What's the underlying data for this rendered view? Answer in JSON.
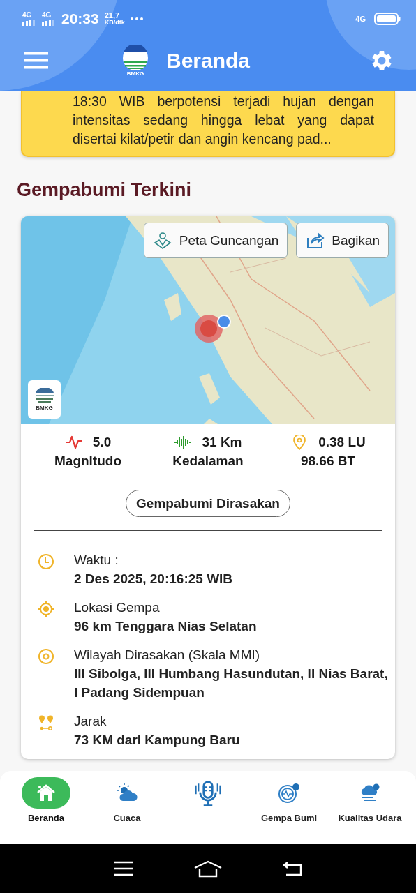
{
  "status_bar": {
    "network_1": "4G",
    "network_2": "4G",
    "time": "20:33",
    "speed": "21,7",
    "speed_unit": "KB/dtk",
    "network_3": "4G"
  },
  "header": {
    "logo_text": "BMKG",
    "title": "Beranda"
  },
  "warning": {
    "text": "18:30 WIB berpotensi terjadi hujan dengan intensitas sedang hingga lebat yang dapat disertai kilat/petir dan angin kencang pad..."
  },
  "section_title": "Gempabumi Terkini",
  "map": {
    "kind": "picture",
    "logo_text": "BMKG",
    "buttons": [
      "Peta Guncangan",
      "Bagikan"
    ]
  },
  "stats": [
    {
      "value": "5.0",
      "label": "Magnitudo",
      "color": "#e53935"
    },
    {
      "value": "31 Km",
      "label": "Kedalaman",
      "color": "#2e9b2e"
    },
    {
      "value": "0.38 LU",
      "label": "98.66 BT",
      "color": "#f0b429"
    }
  ],
  "felt_button": "Gempabumi Dirasakan",
  "details": [
    {
      "label": "Waktu :",
      "value": "2 Des 2025, 20:16:25 WIB"
    },
    {
      "label": "Lokasi Gempa",
      "value": "96 km Tenggara Nias Selatan"
    },
    {
      "label": "Wilayah Dirasakan (Skala MMI)",
      "value": "III Sibolga, III Humbang Hasundutan, II Nias Barat, I Padang Sidempuan"
    },
    {
      "label": "Jarak",
      "value": "73 KM dari Kampung Baru"
    }
  ],
  "bottom_nav": [
    {
      "label": "Beranda",
      "selected": true
    },
    {
      "label": "Cuaca",
      "selected": false
    },
    {
      "selected": false
    },
    {
      "label": "Gempa Bumi",
      "selected": false
    },
    {
      "label": "Kualitas Udara",
      "selected": false
    }
  ]
}
